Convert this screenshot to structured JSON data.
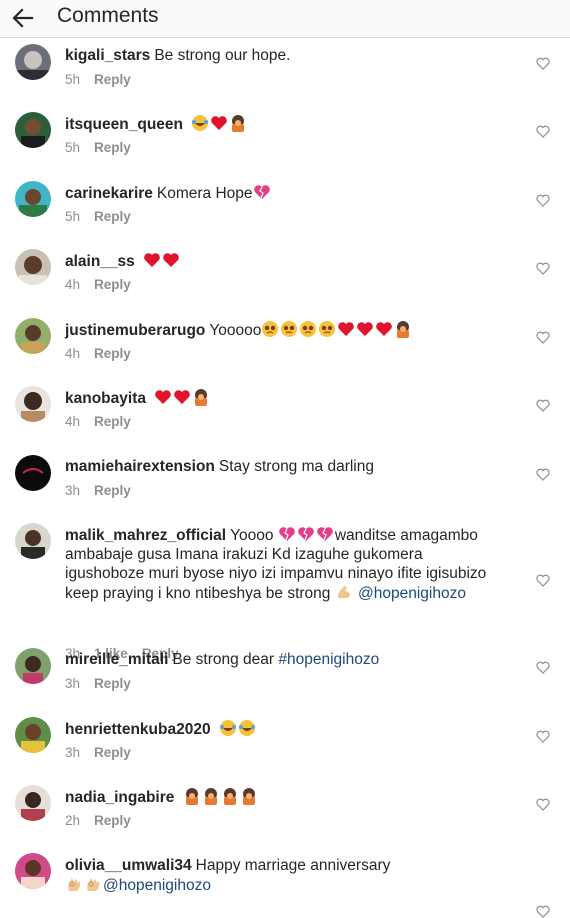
{
  "header": {
    "title": "Comments",
    "back_icon": "arrow-left-icon"
  },
  "comments": [
    {
      "username": "kigali_stars",
      "text": "Be strong our hope.",
      "time": "5h",
      "likes": "",
      "reply": "Reply"
    },
    {
      "username": "itsqueen_queen",
      "text": "",
      "emoji": [
        "laugh-cry",
        "heart",
        "facepalm"
      ],
      "time": "5h",
      "likes": "",
      "reply": "Reply"
    },
    {
      "username": "carinekarire",
      "text": "Komera Hope",
      "emoji_after": [
        "broken-heart"
      ],
      "time": "5h",
      "likes": "",
      "reply": "Reply"
    },
    {
      "username": "alain__ss",
      "text": "",
      "emoji": [
        "heart",
        "heart"
      ],
      "time": "4h",
      "likes": "",
      "reply": "Reply"
    },
    {
      "username": "justinemuberarugo",
      "text": "Yooooo",
      "emoji_after": [
        "crying",
        "crying",
        "crying",
        "crying",
        "heart",
        "heart",
        "heart",
        "facepalm"
      ],
      "time": "4h",
      "likes": "",
      "reply": "Reply"
    },
    {
      "username": "kanobayita",
      "text": "",
      "emoji": [
        "heart",
        "heart",
        "facepalm"
      ],
      "time": "4h",
      "likes": "",
      "reply": "Reply"
    },
    {
      "username": "mamiehairextension",
      "text": "Stay strong ma darling",
      "time": "3h",
      "likes": "",
      "reply": "Reply"
    },
    {
      "username": "malik_mahrez_official",
      "text_parts": [
        "Yoooo ",
        "wanditse amagambo ambabaje gusa Imana irakuzi Kd izaguhe gukomera igushoboze muri byose niyo izi impamvu ninayo ifite igisubizo keep praying i kno ntibeshya be strong "
      ],
      "mention": "@hopenigihozo",
      "time": "3h",
      "likes": "1 like",
      "reply": "Reply"
    },
    {
      "username": "mireille_mitali",
      "text": "Be strong dear ",
      "hashtag": "#hopenigihozo",
      "time": "3h",
      "likes": "",
      "reply": "Reply"
    },
    {
      "username": "henriettenkuba2020",
      "text": "",
      "emoji": [
        "laugh-cry",
        "laugh-cry"
      ],
      "time": "3h",
      "likes": "",
      "reply": "Reply"
    },
    {
      "username": "nadia_ingabire",
      "text": "",
      "emoji": [
        "facepalm",
        "facepalm",
        "facepalm",
        "facepalm"
      ],
      "time": "2h",
      "likes": "",
      "reply": "Reply"
    },
    {
      "username": "olivia__umwali34",
      "text": "Happy marriage anniversary",
      "mention": "@hopenigihozo",
      "time": "",
      "likes": "",
      "reply": ""
    }
  ],
  "colors": {
    "link": "#1c4a7a",
    "meta": "#8e8e8e",
    "heart_red": "#e0142d",
    "broken_heart": "#e43d8a"
  },
  "icons": {
    "like": "heart-outline-icon"
  }
}
